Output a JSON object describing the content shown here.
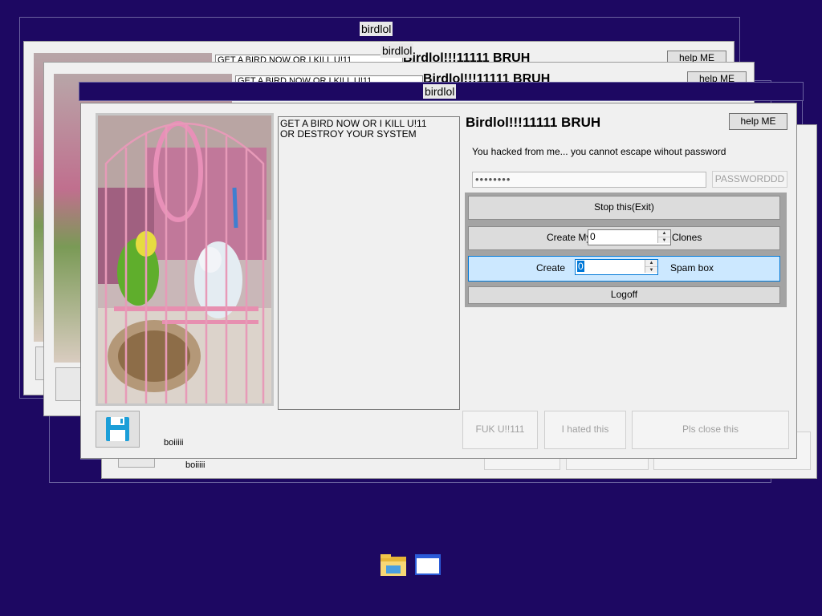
{
  "window": {
    "title": "birdlol",
    "message": "GET A BIRD NOW OR I KILL U!11\nOR DESTROY YOUR SYSTEM",
    "message_short": "GET A BIRD NOW OR I KILL U!11",
    "header": "Birdlol!!!11111    BRUH",
    "help_button": "help ME",
    "hacked_text": "You hacked from me... you cannot escape wihout password",
    "password_value": "••••••••",
    "password_button": "PASSWORDDD",
    "stop_button": "Stop this(Exit)",
    "clones": {
      "prefix": "Create My",
      "value": "0",
      "suffix": "Clones"
    },
    "spam": {
      "prefix": "Create",
      "value": "0",
      "suffix": "Spam box"
    },
    "logoff_button": "Logoff",
    "footer_buttons": [
      "FUK U!!111",
      "I hated this",
      "Pls close this"
    ],
    "boi_label": "boiiiii"
  },
  "colors": {
    "desktop": "#1d0862",
    "highlight_row": "#cce8ff",
    "accent_border": "#0078d7",
    "save_icon": "#1b9ed8"
  },
  "icons": {
    "save": "floppy-disk-icon",
    "taskbar": [
      "file-explorer-icon",
      "app-window-icon"
    ]
  }
}
